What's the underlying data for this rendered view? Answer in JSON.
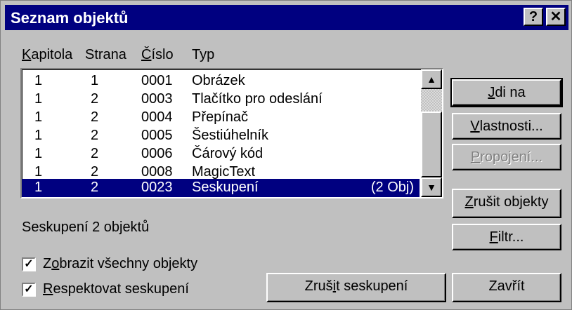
{
  "window": {
    "title": "Seznam objektů",
    "help_glyph": "?",
    "close_glyph": "✕"
  },
  "columns": [
    "Kapitola",
    "Strana",
    "Číslo",
    "Typ"
  ],
  "rows": [
    {
      "kapitola": "1",
      "strana": "1",
      "cislo": "0001",
      "typ": "Obrázek",
      "extra": ""
    },
    {
      "kapitola": "1",
      "strana": "2",
      "cislo": "0003",
      "typ": "Tlačítko pro odeslání",
      "extra": ""
    },
    {
      "kapitola": "1",
      "strana": "2",
      "cislo": "0004",
      "typ": "Přepínač",
      "extra": ""
    },
    {
      "kapitola": "1",
      "strana": "2",
      "cislo": "0005",
      "typ": "Šestiúhelník",
      "extra": ""
    },
    {
      "kapitola": "1",
      "strana": "2",
      "cislo": "0006",
      "typ": "Čárový kód",
      "extra": ""
    },
    {
      "kapitola": "1",
      "strana": "2",
      "cislo": "0008",
      "typ": "MagicText",
      "extra": ""
    },
    {
      "kapitola": "1",
      "strana": "2",
      "cislo": "0023",
      "typ": "Seskupení",
      "extra": "(2 Obj)",
      "selected": true
    }
  ],
  "buttons": {
    "jdi_na": "Jdi na",
    "vlastnosti": "Vlastnosti...",
    "propojeni": "Propojení...",
    "zrusit_objekty": "Zrušit objekty",
    "filtr": "Filtr...",
    "zrusit_seskupeni": "Zrušit seskupení",
    "zavrit": "Zavřít"
  },
  "status": "Seskupení 2 objektů",
  "checkboxes": [
    {
      "label": "Zobrazit všechny objekty",
      "checked": true
    },
    {
      "label": "Respektovat seskupení",
      "checked": true
    }
  ],
  "colors": {
    "titlebar": "#000080",
    "selection": "#000080",
    "face": "#c0c0c0"
  }
}
